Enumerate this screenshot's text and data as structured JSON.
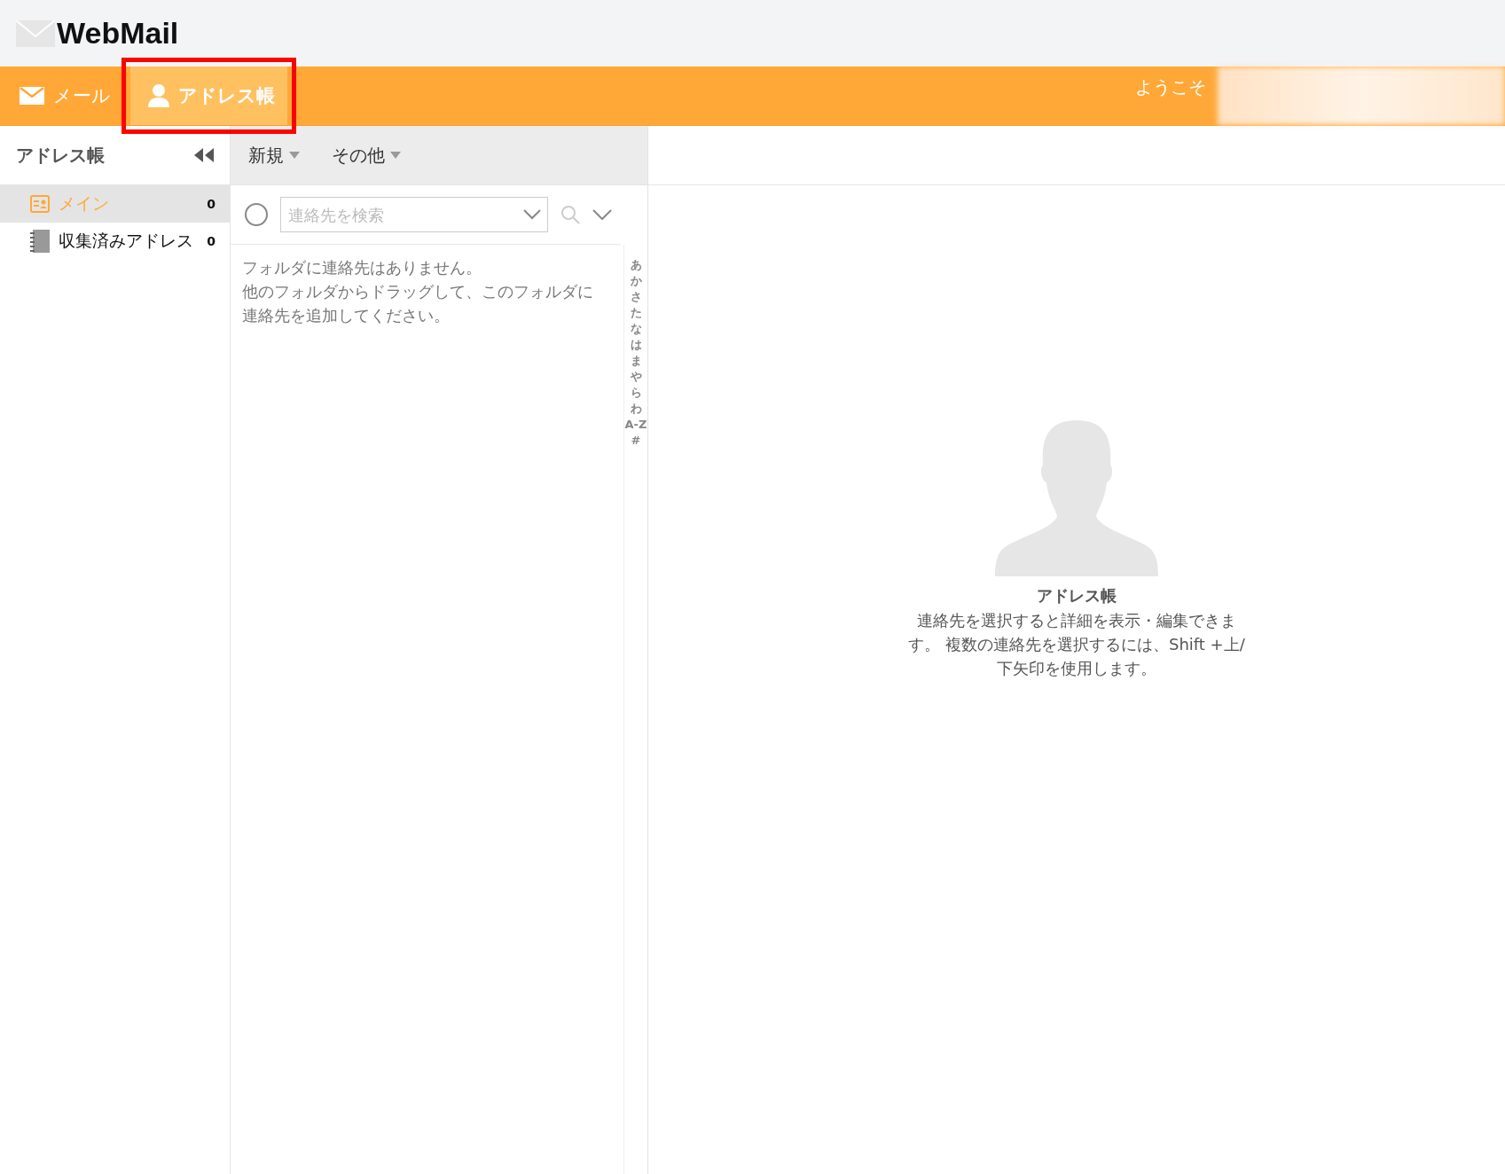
{
  "app": {
    "logo": "WebMail"
  },
  "nav": {
    "tabs": [
      {
        "label": "メール",
        "selected": false
      },
      {
        "label": "アドレス帳",
        "selected": true
      }
    ],
    "welcome": "ようこそ"
  },
  "sidebar": {
    "title": "アドレス帳",
    "items": [
      {
        "label": "メイン",
        "count": "0",
        "selected": true
      },
      {
        "label": "収集済みアドレス",
        "count": "0",
        "selected": false
      }
    ]
  },
  "toolbar": {
    "buttons": [
      "新規",
      "その他"
    ]
  },
  "search": {
    "placeholder": "連絡先を検索",
    "select_all_checked": false
  },
  "list": {
    "empty_message": [
      "フォルダに連絡先はありません。",
      "他のフォルダからドラッグして、このフォルダに",
      "連絡先を追加してください。"
    ]
  },
  "index": [
    "あ",
    "か",
    "さ",
    "た",
    "な",
    "は",
    "ま",
    "や",
    "ら",
    "わ",
    "A-Z",
    "#"
  ],
  "detail": {
    "title": "アドレス帳",
    "message": "連絡先を選択すると詳細を表示・編集できます。 複数の連絡先を選択するには、Shift +上/下矢印を使用します。"
  }
}
